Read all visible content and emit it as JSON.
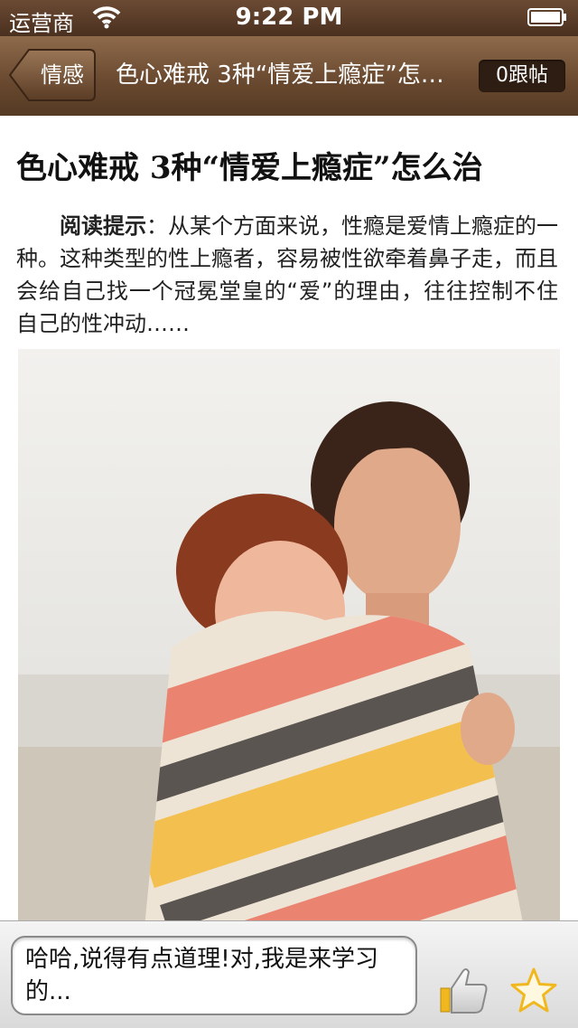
{
  "status_bar": {
    "carrier": "运营商",
    "time": "9:22 PM",
    "wifi_icon": "wifi-icon",
    "battery_icon": "battery-icon"
  },
  "nav": {
    "back_label": "情感",
    "title": "色心难戒 3种“情爱上瘾症”怎么治",
    "reply_label": "0跟帖"
  },
  "article": {
    "title": "色心难戒 3种“情爱上瘾症”怎么治",
    "summary_label": "阅读提示",
    "summary_text": "：从某个方面来说，性瘾是爱情上瘾症的一种。这种类型的性上瘾者，容易被性欲牵着鼻子走，而且会给自己找一个冠冕堂皇的“爱”的理由，往往控制不住自己的性冲动……",
    "image": "couple-wrapped-in-striped-blanket-photo"
  },
  "bottom_bar": {
    "comment_text": "哈哈,说得有点道理!对,我是来学习的...",
    "like_icon": "thumbs-up-icon",
    "favorite_icon": "star-icon"
  },
  "colors": {
    "navbar": "#6a4a30",
    "reply_button": "#2e1d12",
    "star": "#f0b81e"
  }
}
